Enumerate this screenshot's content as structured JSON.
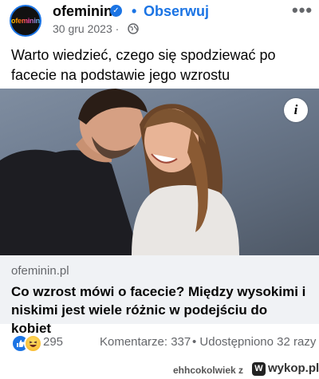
{
  "header": {
    "avatar_text": "ofeminin",
    "page_name": "ofeminin",
    "separator": "•",
    "follow_label": "Obserwuj",
    "more_label": "•••",
    "date": "30 gru 2023 ·"
  },
  "post": {
    "text": "Warto wiedzieć, czego się spodziewać po facecie na podstawie jego wzrostu"
  },
  "link_preview": {
    "info_label": "i",
    "domain": "ofeminin.pl",
    "title": "Co wzrost mówi o facecie? Między wysokimi i niskimi jest wiele różnic w podejściu do kobiet"
  },
  "stats": {
    "reactions_count": "295",
    "comments": "Komentarze: 337",
    "shares": "• Udostępniono 32 razy"
  },
  "footer": {
    "username": "ehhcokolwiek",
    "via": "z",
    "site": "wykop.pl"
  },
  "colors": {
    "accent": "#1b74e4",
    "secondary_text": "#65676b",
    "link_bg": "#f0f2f5"
  }
}
